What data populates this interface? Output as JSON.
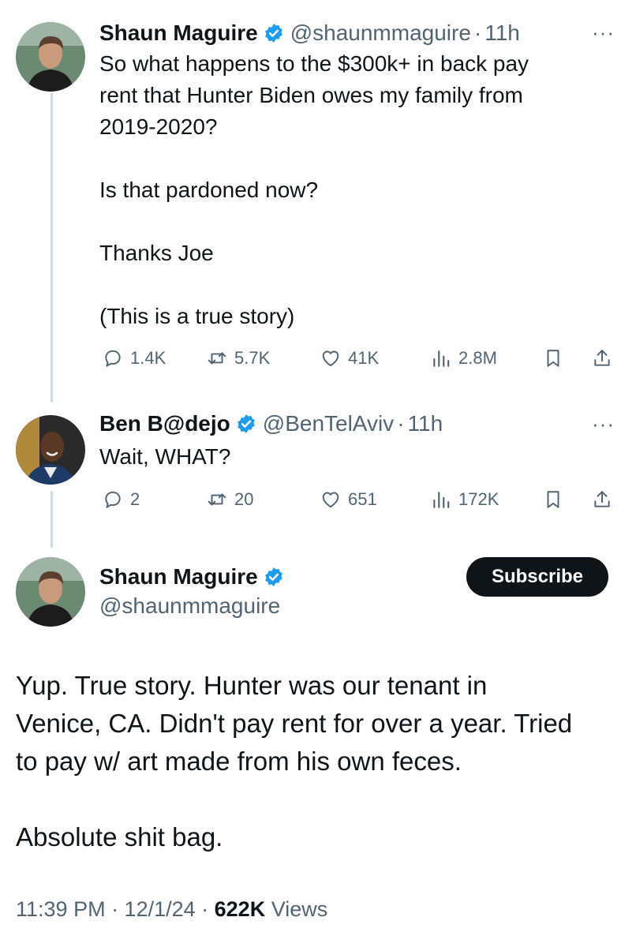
{
  "tweets": [
    {
      "name": "Shaun Maguire",
      "handle": "@shaunmmaguire",
      "separator": "·",
      "time": "11h",
      "text": "So what happens to the $300k+ in back pay\nrent that Hunter Biden owes my family from\n2019-2020?\n\nIs that pardoned now?\n\nThanks Joe\n\n(This is a true story)",
      "stats": {
        "replies": "1.4K",
        "reposts": "5.7K",
        "likes": "41K",
        "views": "2.8M"
      }
    },
    {
      "name": "Ben B@dejo",
      "handle": "@BenTelAviv",
      "separator": "·",
      "time": "11h",
      "text": "Wait, WHAT?",
      "stats": {
        "replies": "2",
        "reposts": "20",
        "likes": "651",
        "views": "172K"
      }
    }
  ],
  "main_tweet": {
    "name": "Shaun Maguire",
    "handle": "@shaunmmaguire",
    "subscribe_label": "Subscribe",
    "text": "Yup. True story. Hunter was our tenant in\nVenice, CA. Didn't pay rent for over a year. Tried\nto pay w/ art made from his own feces.\n\nAbsolute shit bag.",
    "timestamp": "11:39 PM · 12/1/24 · ",
    "views_count": "622K",
    "views_label": " Views"
  },
  "more_glyph": "···",
  "colors": {
    "verified": "#1d9bf0",
    "secondary_text": "#536471",
    "thread_line": "#cfd9de",
    "subscribe_bg": "#0f1419"
  },
  "icons": [
    "reply-icon",
    "repost-icon",
    "like-icon",
    "views-icon",
    "bookmark-icon",
    "share-icon",
    "verified-badge-icon",
    "more-options-icon"
  ]
}
